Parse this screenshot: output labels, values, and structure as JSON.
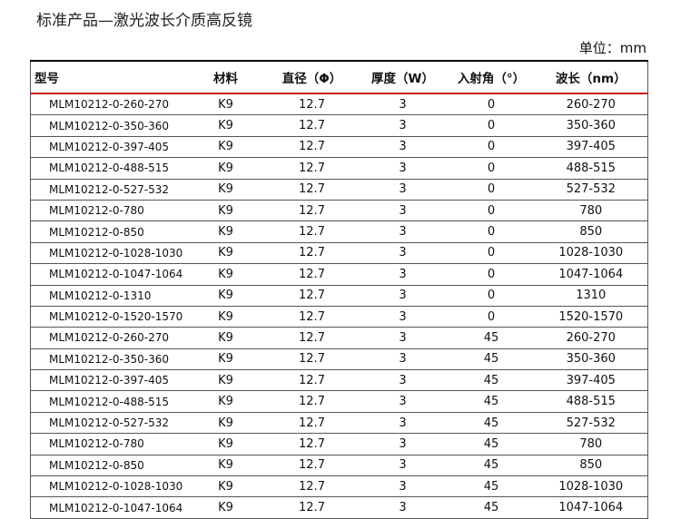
{
  "page": {
    "title": "标准产品—激光波长介质高反镜",
    "unit_label": "单位：mm"
  },
  "table": {
    "headers": [
      "型号",
      "材料",
      "直径（Φ）",
      "厚度（W）",
      "入射角（°）",
      "波长（nm）"
    ],
    "rows": [
      [
        "MLM10212-0-260-270",
        "K9",
        "12.7",
        "3",
        "0",
        "260-270"
      ],
      [
        "MLM10212-0-350-360",
        "K9",
        "12.7",
        "3",
        "0",
        "350-360"
      ],
      [
        "MLM10212-0-397-405",
        "K9",
        "12.7",
        "3",
        "0",
        "397-405"
      ],
      [
        "MLM10212-0-488-515",
        "K9",
        "12.7",
        "3",
        "0",
        "488-515"
      ],
      [
        "MLM10212-0-527-532",
        "K9",
        "12.7",
        "3",
        "0",
        "527-532"
      ],
      [
        "MLM10212-0-780",
        "K9",
        "12.7",
        "3",
        "0",
        "780"
      ],
      [
        "MLM10212-0-850",
        "K9",
        "12.7",
        "3",
        "0",
        "850"
      ],
      [
        "MLM10212-0-1028-1030",
        "K9",
        "12.7",
        "3",
        "0",
        "1028-1030"
      ],
      [
        "MLM10212-0-1047-1064",
        "K9",
        "12.7",
        "3",
        "0",
        "1047-1064"
      ],
      [
        "MLM10212-0-1310",
        "K9",
        "12.7",
        "3",
        "0",
        "1310"
      ],
      [
        "MLM10212-0-1520-1570",
        "K9",
        "12.7",
        "3",
        "0",
        "1520-1570"
      ],
      [
        "MLM10212-0-260-270",
        "K9",
        "12.7",
        "3",
        "45",
        "260-270"
      ],
      [
        "MLM10212-0-350-360",
        "K9",
        "12.7",
        "3",
        "45",
        "350-360"
      ],
      [
        "MLM10212-0-397-405",
        "K9",
        "12.7",
        "3",
        "45",
        "397-405"
      ],
      [
        "MLM10212-0-488-515",
        "K9",
        "12.7",
        "3",
        "45",
        "488-515"
      ],
      [
        "MLM10212-0-527-532",
        "K9",
        "12.7",
        "3",
        "45",
        "527-532"
      ],
      [
        "MLM10212-0-780",
        "K9",
        "12.7",
        "3",
        "45",
        "780"
      ],
      [
        "MLM10212-0-850",
        "K9",
        "12.7",
        "3",
        "45",
        "850"
      ],
      [
        "MLM10212-0-1028-1030",
        "K9",
        "12.7",
        "3",
        "45",
        "1028-1030"
      ],
      [
        "MLM10212-0-1047-1064",
        "K9",
        "12.7",
        "3",
        "45",
        "1047-1064"
      ]
    ]
  },
  "colors": {
    "header_divider": "#c41a1a",
    "grid": "#555555"
  }
}
